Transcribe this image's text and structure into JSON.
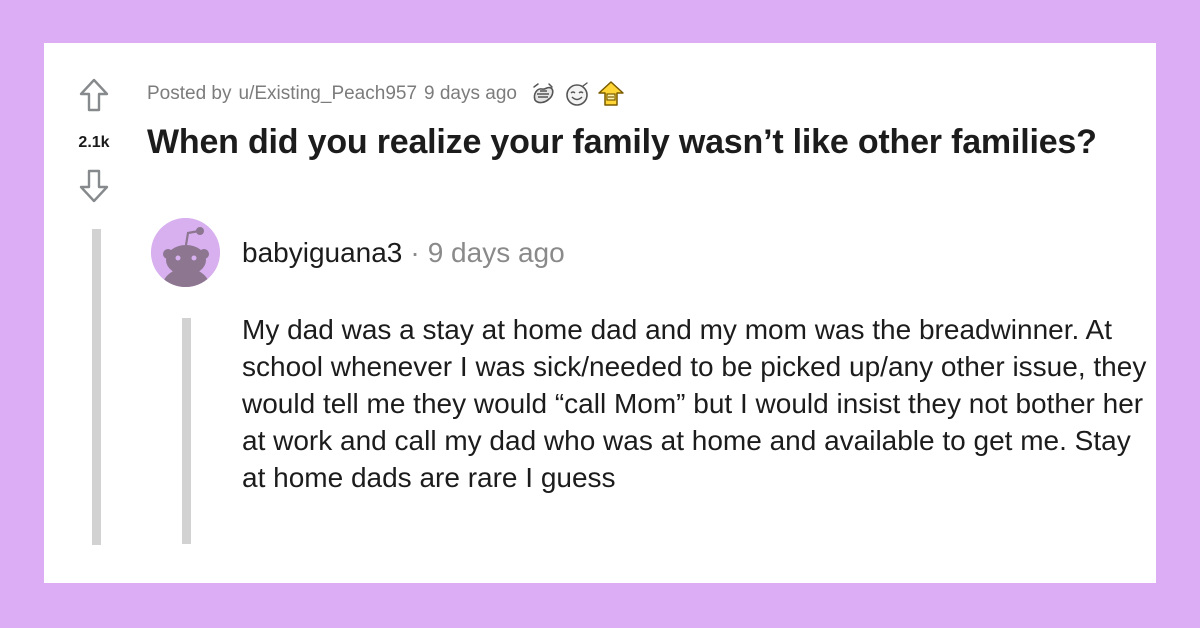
{
  "post": {
    "score": "2.1k",
    "posted_by_prefix": "Posted by",
    "author": "u/Existing_Peach957",
    "time": "9 days ago",
    "awards": [
      "hugz-award-icon",
      "wholesome-award-icon",
      "helpful-award-icon"
    ],
    "title": "When did you realize your family wasn’t like other families?"
  },
  "comment": {
    "author": "babyiguana3",
    "separator": "·",
    "time": "9 days ago",
    "body": "My dad was a stay at home dad and my mom was the breadwinner. At school whenever I was sick/needed to be picked up/any other issue, they would tell me they would “call Mom” but I would insist they not bother her at work and call my dad who was at home and available to get me. Stay at home dads are rare I guess"
  },
  "colors": {
    "background": "#dcacf4",
    "card": "#ffffff",
    "text": "#1c1c1c",
    "muted": "#7c7c7c",
    "thread_line": "#d2d2d2",
    "avatar": "#d8b0ef"
  }
}
